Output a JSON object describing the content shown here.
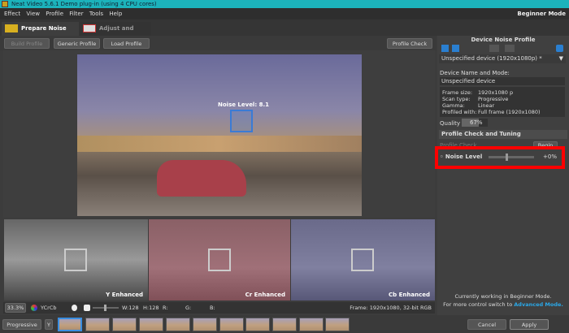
{
  "window": {
    "title": "Neat Video 5.6.1 Demo plug-in (using 4 CPU cores)",
    "mode": "Beginner Mode"
  },
  "menu": [
    "Effect",
    "View",
    "Profile",
    "Filter",
    "Tools",
    "Help"
  ],
  "tabs": [
    {
      "label": "Prepare Noise Profile",
      "active": true
    },
    {
      "label": "Adjust and Preview",
      "active": false
    }
  ],
  "toolbar": {
    "build": "Build Profile",
    "generic": "Generic Profile",
    "load": "Load Profile",
    "check": "Profile Check"
  },
  "viewer": {
    "noise_label": "Noise Level: 8.1"
  },
  "panels": [
    {
      "label": "Y Enhanced"
    },
    {
      "label": "Cr Enhanced"
    },
    {
      "label": "Cb Enhanced"
    }
  ],
  "status": {
    "zoom": "33.3%",
    "channel": "YCrCb",
    "w": "W:128",
    "h": "H:128",
    "r": "R:",
    "g": "G:",
    "b": "B:",
    "frame": "Frame: 1920x1080, 32-bit RGB"
  },
  "right": {
    "title": "Device Noise Profile",
    "device_select": "Unspecified device (1920x1080p) *",
    "name_label": "Device Name and Mode:",
    "name_value": "Unspecified device",
    "info": [
      [
        "Frame size:",
        "1920x1080 p"
      ],
      [
        "Scan type:",
        "Progressive"
      ],
      [
        "Gamma:",
        "Linear"
      ],
      [
        "Profiled with:",
        "Full frame (1920x1080)"
      ]
    ],
    "quality_label": "Quality",
    "quality_value": "67%",
    "quality": 67,
    "check_title": "Profile Check and Tuning",
    "profile_check": "Profile Check",
    "begin": "Begin",
    "noise_level_label": "Noise Level",
    "noise_level_value": "+0%",
    "mode_line1": "Currently working in Beginner Mode.",
    "mode_line2": "For more control switch to",
    "mode_link": "Advanced Mode."
  },
  "bottom": {
    "scan": "Progressive",
    "cancel": "Cancel",
    "apply": "Apply"
  },
  "colors": {
    "titlebar": "#1cb3bb",
    "highlight": "#ff0000",
    "link": "#2aa8e8",
    "selection": "#3a7bd5"
  }
}
